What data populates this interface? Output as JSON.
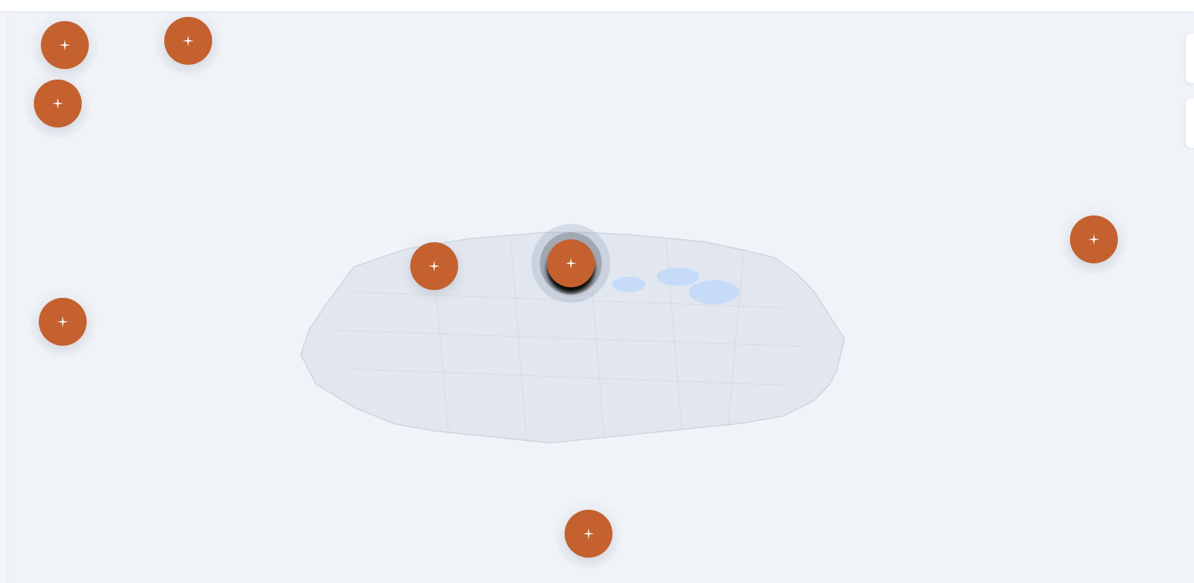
{
  "theme": {
    "marker_color": "#c4612f",
    "marker_glyph_color": "#ffffff",
    "background": "#f0f4f9",
    "land_fill": "#e2e7ef",
    "land_stroke": "#cdd4de",
    "water_fill": "#c6dbf7"
  },
  "map": {
    "markers": [
      {
        "id": "m1",
        "icon": "sparkle-icon",
        "selected": false
      },
      {
        "id": "m2",
        "icon": "sparkle-icon",
        "selected": false
      },
      {
        "id": "m3",
        "icon": "sparkle-icon",
        "selected": false
      },
      {
        "id": "m4",
        "icon": "sparkle-icon",
        "selected": false
      },
      {
        "id": "m5",
        "icon": "sparkle-icon",
        "selected": true
      },
      {
        "id": "m6",
        "icon": "sparkle-icon",
        "selected": false
      },
      {
        "id": "m7",
        "icon": "sparkle-icon",
        "selected": false
      },
      {
        "id": "m8",
        "icon": "sparkle-icon",
        "selected": false
      }
    ]
  },
  "panels": {
    "right_tabs": [
      {
        "name": "panel-tab-top"
      },
      {
        "name": "panel-tab-bottom"
      }
    ]
  }
}
